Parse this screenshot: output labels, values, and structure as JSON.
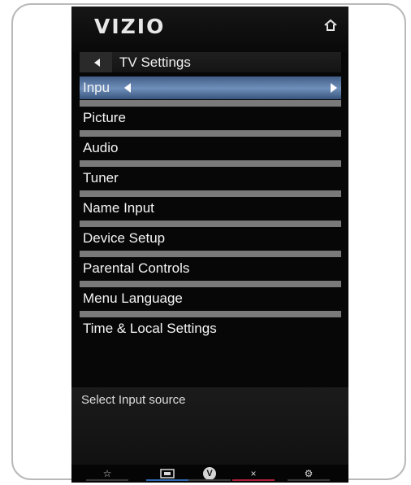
{
  "tv": {
    "logo": "VIZIO",
    "title": "TV Settings",
    "icons": {
      "home": "home-icon",
      "back": "back-arrow-icon",
      "star": "star-icon",
      "input": "input-icon",
      "vizio": "vizio-v-icon",
      "close": "close-icon",
      "settings": "gear-icon"
    }
  },
  "menu": {
    "items": [
      {
        "label": "Inpu",
        "selected": true
      },
      {
        "label": "Picture"
      },
      {
        "label": "Audio"
      },
      {
        "label": "Tuner"
      },
      {
        "label": "Name Input"
      },
      {
        "label": "Device Setup"
      },
      {
        "label": "Parental Controls"
      },
      {
        "label": "Menu Language"
      },
      {
        "label": "Time & Local Settings"
      }
    ]
  },
  "description": {
    "text": "Select Input source"
  },
  "bottom_nav": {
    "star_label": "☆",
    "input_label": "",
    "v_label": "V",
    "close_label": "×",
    "settings_label": "⚙"
  },
  "colors": {
    "selected_row": "#5f80ad",
    "divider": "#7a7a7a",
    "background": "#070707",
    "blue_accent": "#3067b1",
    "red_accent": "#b11e3c"
  }
}
